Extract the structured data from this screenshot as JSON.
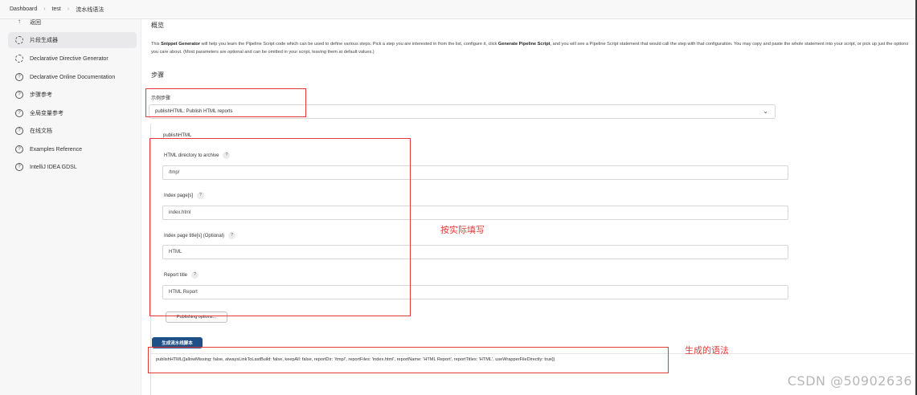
{
  "breadcrumb": [
    "Dashboard",
    "test",
    "流水线语法"
  ],
  "sidebar": {
    "items": [
      {
        "label": "返回",
        "icon": "arrow-up-icon"
      },
      {
        "label": "片段生成器",
        "icon": "gear-icon"
      },
      {
        "label": "Declarative Directive Generator",
        "icon": "gear-icon"
      },
      {
        "label": "Declarative Online Documentation",
        "icon": "help-icon"
      },
      {
        "label": "步骤参考",
        "icon": "help-icon"
      },
      {
        "label": "全局变量参考",
        "icon": "help-icon"
      },
      {
        "label": "在线文档",
        "icon": "help-icon"
      },
      {
        "label": "Examples Reference",
        "icon": "help-icon"
      },
      {
        "label": "IntelliJ IDEA GDSL",
        "icon": "help-icon"
      }
    ]
  },
  "main": {
    "overview_title": "概览",
    "description": {
      "p1": "This ",
      "b1": "Snippet Generator",
      "p2": " will help you learn the Pipeline Script code which can be used to define various steps. Pick a step you are interested in from the list, configure it, click ",
      "b2": "Generate Pipeline Script",
      "p3": ", and you will see a Pipeline Script statement that would call the step with that configuration. You may copy and paste the whole statement into your script, or pick up just the options you care about. (Most parameters are optional and can be omitted in your script, leaving them at default values.)"
    },
    "steps_title": "步骤",
    "sample_step_label": "示例步骤",
    "sample_step_value": "publishHTML: Publish HTML reports",
    "publish_title": "publishHTML",
    "fields": [
      {
        "label": "HTML directory to archive",
        "value": "/tmp/"
      },
      {
        "label": "Index page[s]",
        "value": "index.html"
      },
      {
        "label": "Index page title[s] (Optional)",
        "value": "HTML"
      },
      {
        "label": "Report title",
        "value": "HTML Report"
      }
    ],
    "publishing_options_label": "Publishing options...",
    "generate_button_label": "生成流水线脚本",
    "generated_script": "publishHTML([allowMissing: false, alwaysLinkToLastBuild: false, keepAll: false, reportDir: '/tmp/', reportFiles: 'index.html', reportName: 'HTML Report', reportTitles: 'HTML', useWrapperFileDirectly: true])"
  },
  "annotations": {
    "note_fill": "按实际填写",
    "note_syntax": "生成的语法",
    "color": "#e53935"
  },
  "watermark": "CSDN @50902636"
}
